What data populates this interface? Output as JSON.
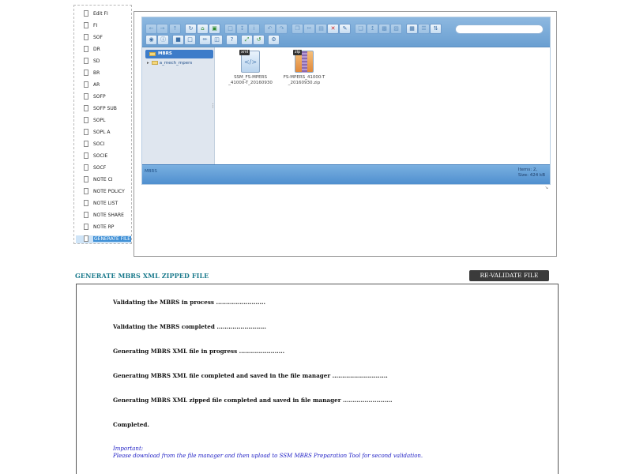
{
  "tree": {
    "items": [
      {
        "label": "Edit FI"
      },
      {
        "label": "FI"
      },
      {
        "label": "SOF"
      },
      {
        "label": "DR"
      },
      {
        "label": "SD"
      },
      {
        "label": "BR"
      },
      {
        "label": "AR"
      },
      {
        "label": "SOFP"
      },
      {
        "label": "SOFP SUB"
      },
      {
        "label": "SOPL"
      },
      {
        "label": "SOPL A"
      },
      {
        "label": "SOCI"
      },
      {
        "label": "SOCIE"
      },
      {
        "label": "SOCF"
      },
      {
        "label": "NOTE CI"
      },
      {
        "label": "NOTE POLICY"
      },
      {
        "label": "NOTE LIST"
      },
      {
        "label": "NOTE SHARE"
      },
      {
        "label": "NOTE RP"
      },
      {
        "label": "GENERATE FILE"
      }
    ],
    "selected_index": 19
  },
  "file_manager": {
    "nav": {
      "root": "MBRS",
      "child": "a_mech_mpers"
    },
    "files": [
      {
        "name_line1": "SSM_FS-MPERS",
        "name_line2": "_41000-T_20160930",
        "tag": "xml",
        "icon": "xml-file-icon"
      },
      {
        "name_line1": "FS-MPERS_41000-T",
        "name_line2": "_20160930.zip",
        "tag": "zip",
        "icon": "zip-file-icon"
      }
    ],
    "status": {
      "left": "MBRS",
      "items": "Items: 2,",
      "size": "Size: 424 kB"
    }
  },
  "generate": {
    "title": "GENERATE MBRS XML ZIPPED FILE",
    "revalidate_label": "RE-VALIDATE FILE",
    "log": [
      "Validating the MBRS in process .........................",
      "Validating the MBRS completed .........................",
      "Generating MBRS XML file in progress .......................",
      "Generating MBRS XML file completed and saved in the file manager ............................",
      "Generating MBRS XML zipped file completed and saved in file manager .........................",
      "Completed."
    ],
    "important_label": "Important:",
    "important_text": "Please download from the file manager and then upload to SSM MBRS Preparation Tool for second validation."
  },
  "colors": {
    "title_teal": "#1b7a8c",
    "button_dark": "#3b3b3b",
    "important_blue": "#1c1cc4",
    "selection_blue": "#3d8fd6"
  }
}
